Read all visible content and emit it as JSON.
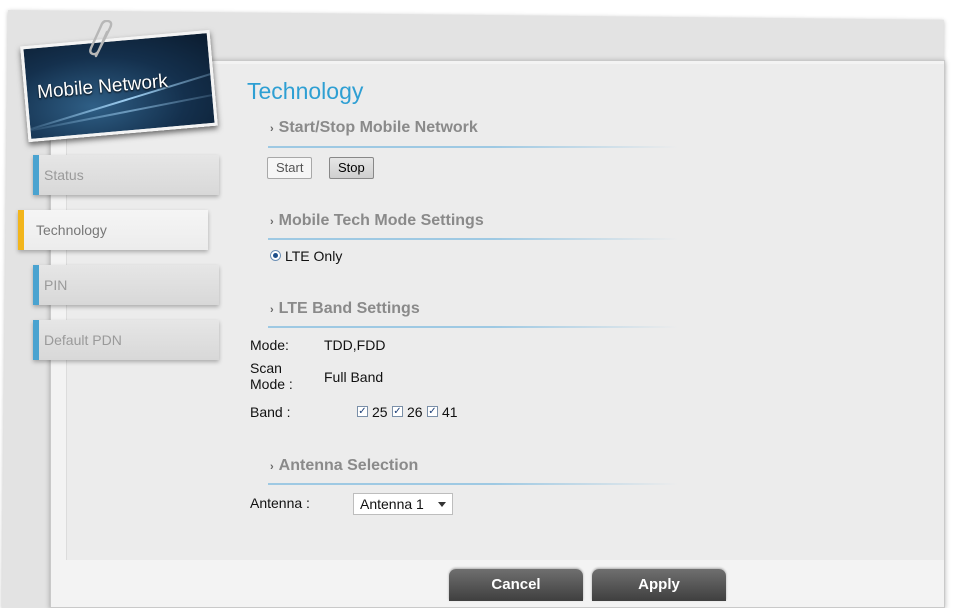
{
  "badge": {
    "title": "Mobile Network"
  },
  "nav": [
    {
      "label": "Status"
    },
    {
      "label": "Technology"
    },
    {
      "label": "PIN"
    },
    {
      "label": "Default PDN"
    }
  ],
  "page_title": "Technology",
  "sections": {
    "start_stop": {
      "title": "Start/Stop Mobile Network",
      "start_label": "Start",
      "stop_label": "Stop"
    },
    "tech_mode": {
      "title": "Mobile Tech Mode Settings",
      "option_label": "LTE Only"
    },
    "lte_band": {
      "title": "LTE Band Settings",
      "mode_label": "Mode:",
      "mode_value": "TDD,FDD",
      "scan_label_1": "Scan",
      "scan_label_2": "Mode :",
      "scan_value": "Full Band",
      "band_label": "Band :",
      "bands": [
        "25",
        "26",
        "41"
      ]
    },
    "antenna": {
      "title": "Antenna Selection",
      "label": "Antenna :",
      "selected": "Antenna 1"
    }
  },
  "footer": {
    "cancel_label": "Cancel",
    "apply_label": "Apply"
  },
  "colors": {
    "title_blue": "#2e9fd3",
    "active_marker": "#f2b51b",
    "inactive_marker": "#4aa3d0",
    "section_line": "#9ec9e3"
  },
  "icons": [
    "paperclip-icon",
    "chevron-right-icon",
    "radio-selected-icon",
    "checkbox-checked-icon",
    "dropdown-arrow-icon"
  ]
}
